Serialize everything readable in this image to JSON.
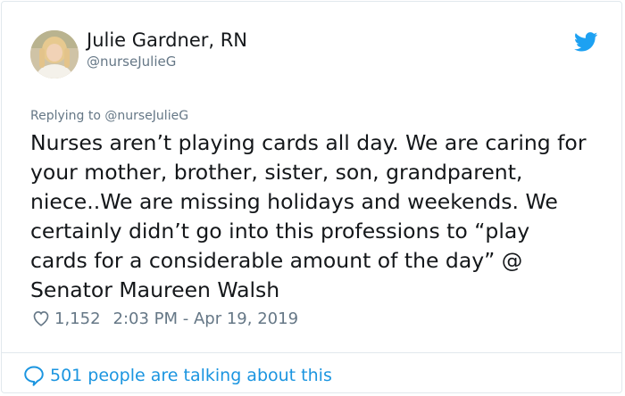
{
  "tweet": {
    "author_name": "Julie Gardner, RN",
    "author_handle": "@nurseJulieG",
    "replying_prefix": "Replying to",
    "replying_handle": "@nurseJulieG",
    "text_lines": [
      "Nurses aren’t playing cards all day. We are caring for",
      "your mother, brother, sister, son, grandparent,",
      "niece..We are missing holidays and weekends. We",
      "certainly didn’t go into this professions to “play",
      "cards for a considerable amount of the day” @",
      "Senator Maureen Walsh"
    ],
    "likes": "1,152",
    "timestamp": "2:03 PM - Apr 19, 2019",
    "talking_text": "501 people are talking about this"
  },
  "icons": {
    "brand": "twitter-bird-icon",
    "like": "heart-icon",
    "conversation": "speech-bubble-icon"
  },
  "colors": {
    "brand_blue": "#1da1f2",
    "link_blue": "#1b95e0",
    "text_primary": "#14171a",
    "text_secondary": "#657786",
    "border": "#e1e8ed"
  }
}
